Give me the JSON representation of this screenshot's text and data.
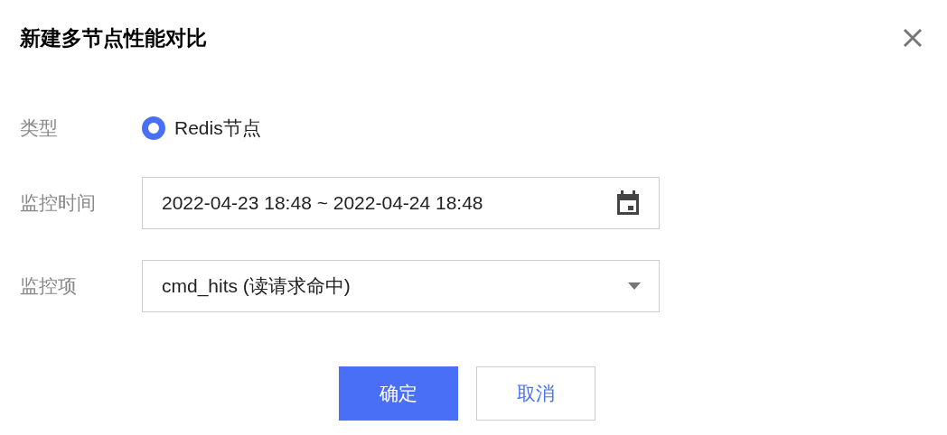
{
  "dialog": {
    "title": "新建多节点性能对比"
  },
  "form": [
    {
      "label": "类型",
      "kind": "radio",
      "options": [
        {
          "label": "Redis节点",
          "selected": true
        }
      ]
    },
    {
      "label": "监控时间",
      "kind": "date",
      "value": "2022-04-23 18:48 ~ 2022-04-24 18:48"
    },
    {
      "label": "监控项",
      "kind": "select",
      "value": "cmd_hits (读请求命中)"
    }
  ],
  "buttons": [
    {
      "label": "确定",
      "kind": "primary"
    },
    {
      "label": "取消",
      "kind": "secondary"
    }
  ]
}
